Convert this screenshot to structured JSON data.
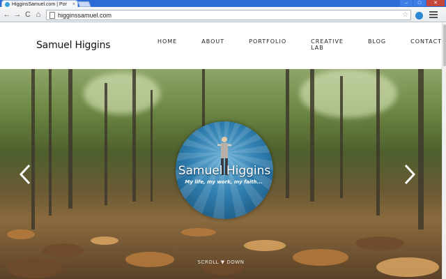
{
  "browser": {
    "tab_title": "HigginsSamuel.com | Por",
    "tab_close": "×",
    "url": "higginssamuel.com",
    "back": "←",
    "forward": "→",
    "reload": "C",
    "home": "⌂",
    "star": "☆",
    "window_minimize": "–",
    "window_maximize": "□",
    "window_close": "✕",
    "chrome_color": "#2a6bd6"
  },
  "site": {
    "logo": "Samuel Higgins",
    "nav": [
      "HOME",
      "ABOUT",
      "PORTFOLIO",
      "CREATIVE LAB",
      "BLOG",
      "CONTACT"
    ]
  },
  "hero": {
    "badge_title": "Samuel Higgins",
    "badge_tagline": "My life, my work, my faith...",
    "scroll_label": "SCROLL ▼ DOWN",
    "prev_icon": "chevron-left-icon",
    "next_icon": "chevron-right-icon",
    "badge_color": "#2f7fb0"
  }
}
